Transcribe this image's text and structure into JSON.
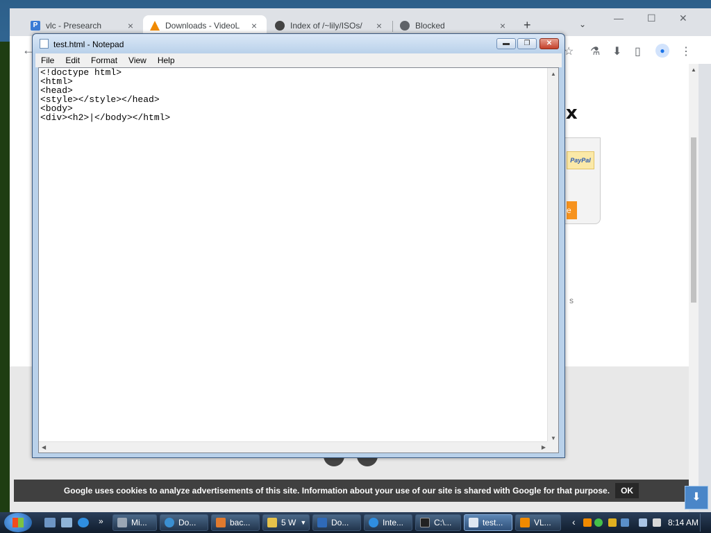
{
  "browser": {
    "tabs": [
      {
        "title": "vlc - Presearch",
        "icon": "presearch-icon",
        "active": false
      },
      {
        "title": "Downloads - VideoL",
        "icon": "vlc-cone-icon",
        "active": true
      },
      {
        "title": "Index of /~lily/ISOs/",
        "icon": "github-icon",
        "active": false
      },
      {
        "title": "Blocked",
        "icon": "globe-icon",
        "active": false
      }
    ],
    "close_glyph": "×",
    "new_tab_glyph": "+",
    "tab_search_glyph": "⌄",
    "window_controls": {
      "minimize": "—",
      "maximize": "☐",
      "close": "✕"
    },
    "toolbar": {
      "back": "←",
      "bookmark": "☆",
      "extension": "⚗",
      "download": "⬇",
      "sidepanel": "▯",
      "menu": "⋮",
      "profile": "●"
    }
  },
  "page": {
    "logo_fragment": "ix",
    "paypal_label": "PayPal",
    "orange_fragment": "e",
    "text_fragment": "s",
    "cookie_banner": {
      "text": "Google uses cookies to analyze advertisements of this site. Information about your use of our site is shared with Google for that purpose.",
      "ok_label": "OK"
    },
    "corner_button": "⬇"
  },
  "notepad": {
    "title": "test.html - Notepad",
    "menu": [
      "File",
      "Edit",
      "Format",
      "View",
      "Help"
    ],
    "buttons": {
      "minimize": "▬",
      "maximize": "❐",
      "close": "✕"
    },
    "content": "<!doctype html>\n<html>\n<head>\n<style></style></head>\n<body>\n<div><h2>|</body></html>"
  },
  "taskbar": {
    "tasks": [
      {
        "label": "Mi...",
        "icon_color": "#9aa6b4"
      },
      {
        "label": "Do...",
        "icon_color": "#3b8fd0"
      },
      {
        "label": "bac...",
        "icon_color": "#e07a2e"
      },
      {
        "label": "5 W",
        "icon_color": "#e6c24a"
      },
      {
        "label": "Do...",
        "icon_color": "#2f6ab8"
      },
      {
        "label": "Inte...",
        "icon_color": "#2f8ee0"
      },
      {
        "label": "C:\\...",
        "icon_color": "#222222"
      },
      {
        "label": "test...",
        "icon_color": "#dfe7f1"
      },
      {
        "label": "VL...",
        "icon_color": "#f08a00"
      }
    ],
    "clock": "8:14 AM",
    "tray_arrow": "‹",
    "overflow": "»"
  }
}
